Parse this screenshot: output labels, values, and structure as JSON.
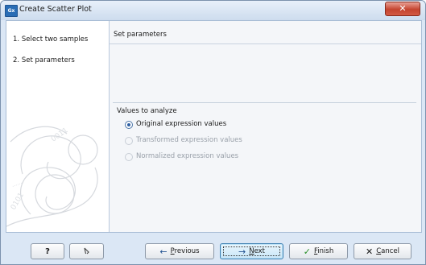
{
  "window": {
    "title": "Create Scatter Plot",
    "app_icon_text": "Gx"
  },
  "steps": [
    {
      "number": "1.",
      "label": "Select two samples"
    },
    {
      "number": "2.",
      "label": "Set parameters"
    }
  ],
  "panel": {
    "title": "Set parameters",
    "group_label": "Values to analyze",
    "options": [
      {
        "label": "Original expression values",
        "selected": true,
        "enabled": true
      },
      {
        "label": "Transformed expression values",
        "selected": false,
        "enabled": false
      },
      {
        "label": "Normalized expression values",
        "selected": false,
        "enabled": false
      }
    ]
  },
  "buttons": {
    "help": "?",
    "previous_prefix": "P",
    "previous_rest": "revious",
    "next_prefix": "N",
    "next_rest": "ext",
    "finish_prefix": "F",
    "finish_rest": "inish",
    "cancel_prefix": "C",
    "cancel_rest": "ancel"
  },
  "icons": [
    "close-icon",
    "app-icon",
    "help-icon",
    "reset-icon",
    "arrow-left-icon",
    "arrow-right-icon",
    "checkmark-icon",
    "x-icon"
  ],
  "colors": {
    "accent": "#2d5fa3",
    "title_bar": "#cddcee",
    "close": "#c4442f",
    "finish_check": "#2a8f2a"
  }
}
